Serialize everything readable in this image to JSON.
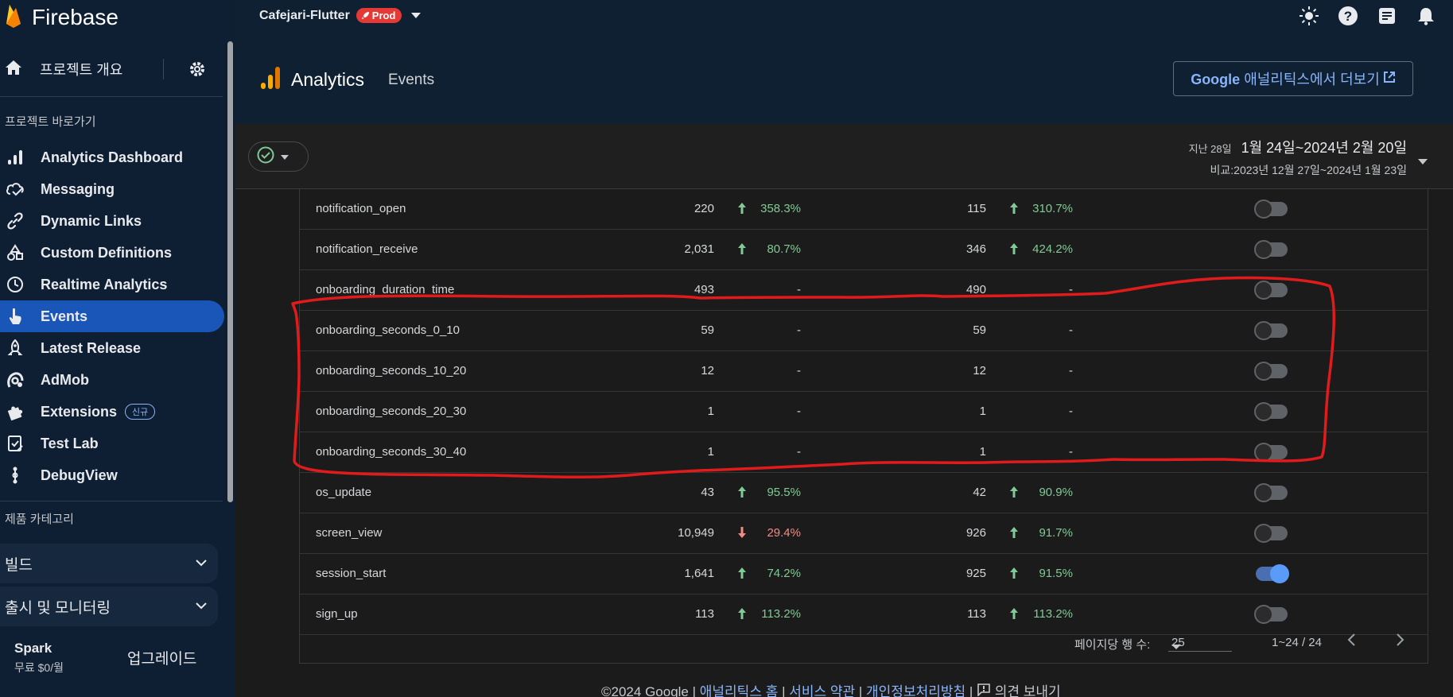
{
  "brand": {
    "name": "Firebase"
  },
  "sidebar": {
    "overview_label": "프로젝트 개요",
    "shortcuts_label": "프로젝트 바로가기",
    "items": [
      {
        "label": "Analytics Dashboard",
        "icon": "bar-chart-icon"
      },
      {
        "label": "Messaging",
        "icon": "cloud-message-icon"
      },
      {
        "label": "Dynamic Links",
        "icon": "link-icon"
      },
      {
        "label": "Custom Definitions",
        "icon": "shapes-icon"
      },
      {
        "label": "Realtime Analytics",
        "icon": "clock-icon"
      },
      {
        "label": "Events",
        "icon": "touch-icon",
        "active": true
      },
      {
        "label": "Latest Release",
        "icon": "rocket-icon"
      },
      {
        "label": "AdMob",
        "icon": "admob-icon"
      },
      {
        "label": "Extensions",
        "icon": "puzzle-icon",
        "badge": "신규"
      },
      {
        "label": "Test Lab",
        "icon": "checklist-icon"
      },
      {
        "label": "DebugView",
        "icon": "debug-icon"
      }
    ],
    "category_label": "제품 카테고리",
    "categories": [
      {
        "label": "빌드"
      },
      {
        "label": "출시 및 모니터링"
      }
    ],
    "plan": {
      "name": "Spark",
      "price": "무료 $0/월",
      "upgrade": "업그레이드"
    }
  },
  "header": {
    "project": "Cafejari-Flutter",
    "env_badge": "Prod",
    "title": "Analytics",
    "subtitle": "Events",
    "ga_link_brand": "Google",
    "ga_link_text": " 애널리틱스에서 더보기"
  },
  "filter": {
    "range_prefix": "지난 28일",
    "range": "1월 24일~2024년 2월 20일",
    "compare": "비교:2023년 12월 27일~2024년 1월 23일"
  },
  "table": {
    "rows": [
      {
        "name": "notification_open",
        "v1": "220",
        "t1": "up",
        "p1": "358.3%",
        "v2": "115",
        "t2": "up",
        "p2": "310.7%",
        "on": false
      },
      {
        "name": "notification_receive",
        "v1": "2,031",
        "t1": "up",
        "p1": "80.7%",
        "v2": "346",
        "t2": "up",
        "p2": "424.2%",
        "on": false
      },
      {
        "name": "onboarding_duration_time",
        "v1": "493",
        "t1": "none",
        "p1": "-",
        "v2": "490",
        "t2": "none",
        "p2": "-",
        "on": false
      },
      {
        "name": "onboarding_seconds_0_10",
        "v1": "59",
        "t1": "none",
        "p1": "-",
        "v2": "59",
        "t2": "none",
        "p2": "-",
        "on": false
      },
      {
        "name": "onboarding_seconds_10_20",
        "v1": "12",
        "t1": "none",
        "p1": "-",
        "v2": "12",
        "t2": "none",
        "p2": "-",
        "on": false
      },
      {
        "name": "onboarding_seconds_20_30",
        "v1": "1",
        "t1": "none",
        "p1": "-",
        "v2": "1",
        "t2": "none",
        "p2": "-",
        "on": false
      },
      {
        "name": "onboarding_seconds_30_40",
        "v1": "1",
        "t1": "none",
        "p1": "-",
        "v2": "1",
        "t2": "none",
        "p2": "-",
        "on": false
      },
      {
        "name": "os_update",
        "v1": "43",
        "t1": "up",
        "p1": "95.5%",
        "v2": "42",
        "t2": "up",
        "p2": "90.9%",
        "on": false
      },
      {
        "name": "screen_view",
        "v1": "10,949",
        "t1": "down",
        "p1": "29.4%",
        "v2": "926",
        "t2": "up",
        "p2": "91.7%",
        "on": false
      },
      {
        "name": "session_start",
        "v1": "1,641",
        "t1": "up",
        "p1": "74.2%",
        "v2": "925",
        "t2": "up",
        "p2": "91.5%",
        "on": true
      },
      {
        "name": "sign_up",
        "v1": "113",
        "t1": "up",
        "p1": "113.2%",
        "v2": "113",
        "t2": "up",
        "p2": "113.2%",
        "on": false
      }
    ],
    "pager": {
      "rows_per_page_label": "페이지당 행 수:",
      "rows_per_page": "25",
      "range": "1~24 / 24"
    }
  },
  "footer": {
    "copyright": "©2024 Google",
    "links": [
      "애널리틱스 홈",
      "서비스 약관",
      "개인정보처리방침"
    ],
    "feedback": "의견 보내기"
  },
  "colors": {
    "up": "#81c995",
    "down": "#f28b82",
    "annotation": "#e01b1b",
    "accent": "#1a56b8"
  }
}
